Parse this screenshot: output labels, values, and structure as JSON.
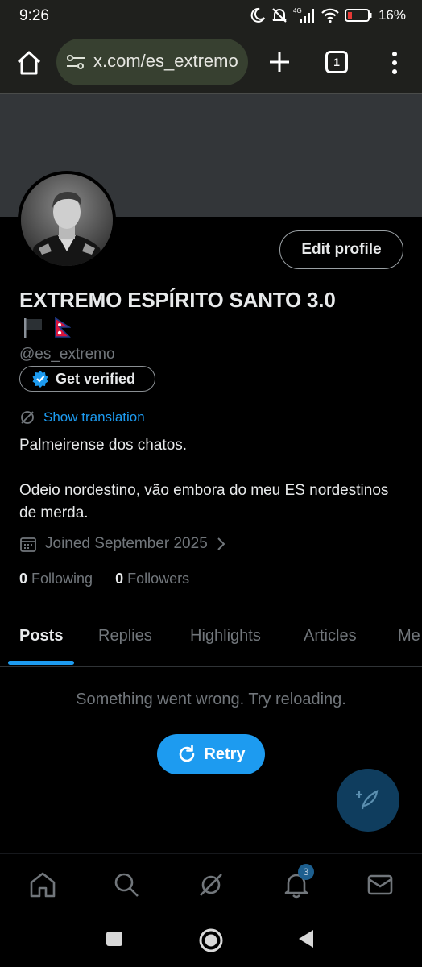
{
  "status_bar": {
    "time": "9:26",
    "network": "4G",
    "battery": "16%"
  },
  "browser": {
    "url": "x.com/es_extremo",
    "tab_count": "1"
  },
  "profile": {
    "name": "EXTREMO ESPÍRITO SANTO 3.0",
    "handle": "@es_extremo",
    "edit_button": "Edit profile",
    "get_verified": "Get verified",
    "show_translation": "Show translation",
    "bio_line1": "Palmeirense dos chatos.",
    "bio_line2": "Odeio nordestino, vão embora do meu ES nordestinos de merda.",
    "joined": "Joined September 2025",
    "following_count": "0",
    "following_label": "Following",
    "followers_count": "0",
    "followers_label": "Followers"
  },
  "tabs": [
    {
      "label": "Posts",
      "active": true
    },
    {
      "label": "Replies"
    },
    {
      "label": "Highlights"
    },
    {
      "label": "Articles"
    },
    {
      "label": "Me"
    }
  ],
  "content": {
    "error": "Something went wrong. Try reloading.",
    "retry": "Retry"
  },
  "bottom_nav": {
    "items": [
      "home-icon",
      "search-icon",
      "grok-icon",
      "notifications-icon",
      "messages-icon"
    ],
    "notification_badge": "3"
  },
  "colors": {
    "accent": "#1d9bf0",
    "background": "#000000",
    "muted_text": "#71767b",
    "banner": "#333639"
  }
}
